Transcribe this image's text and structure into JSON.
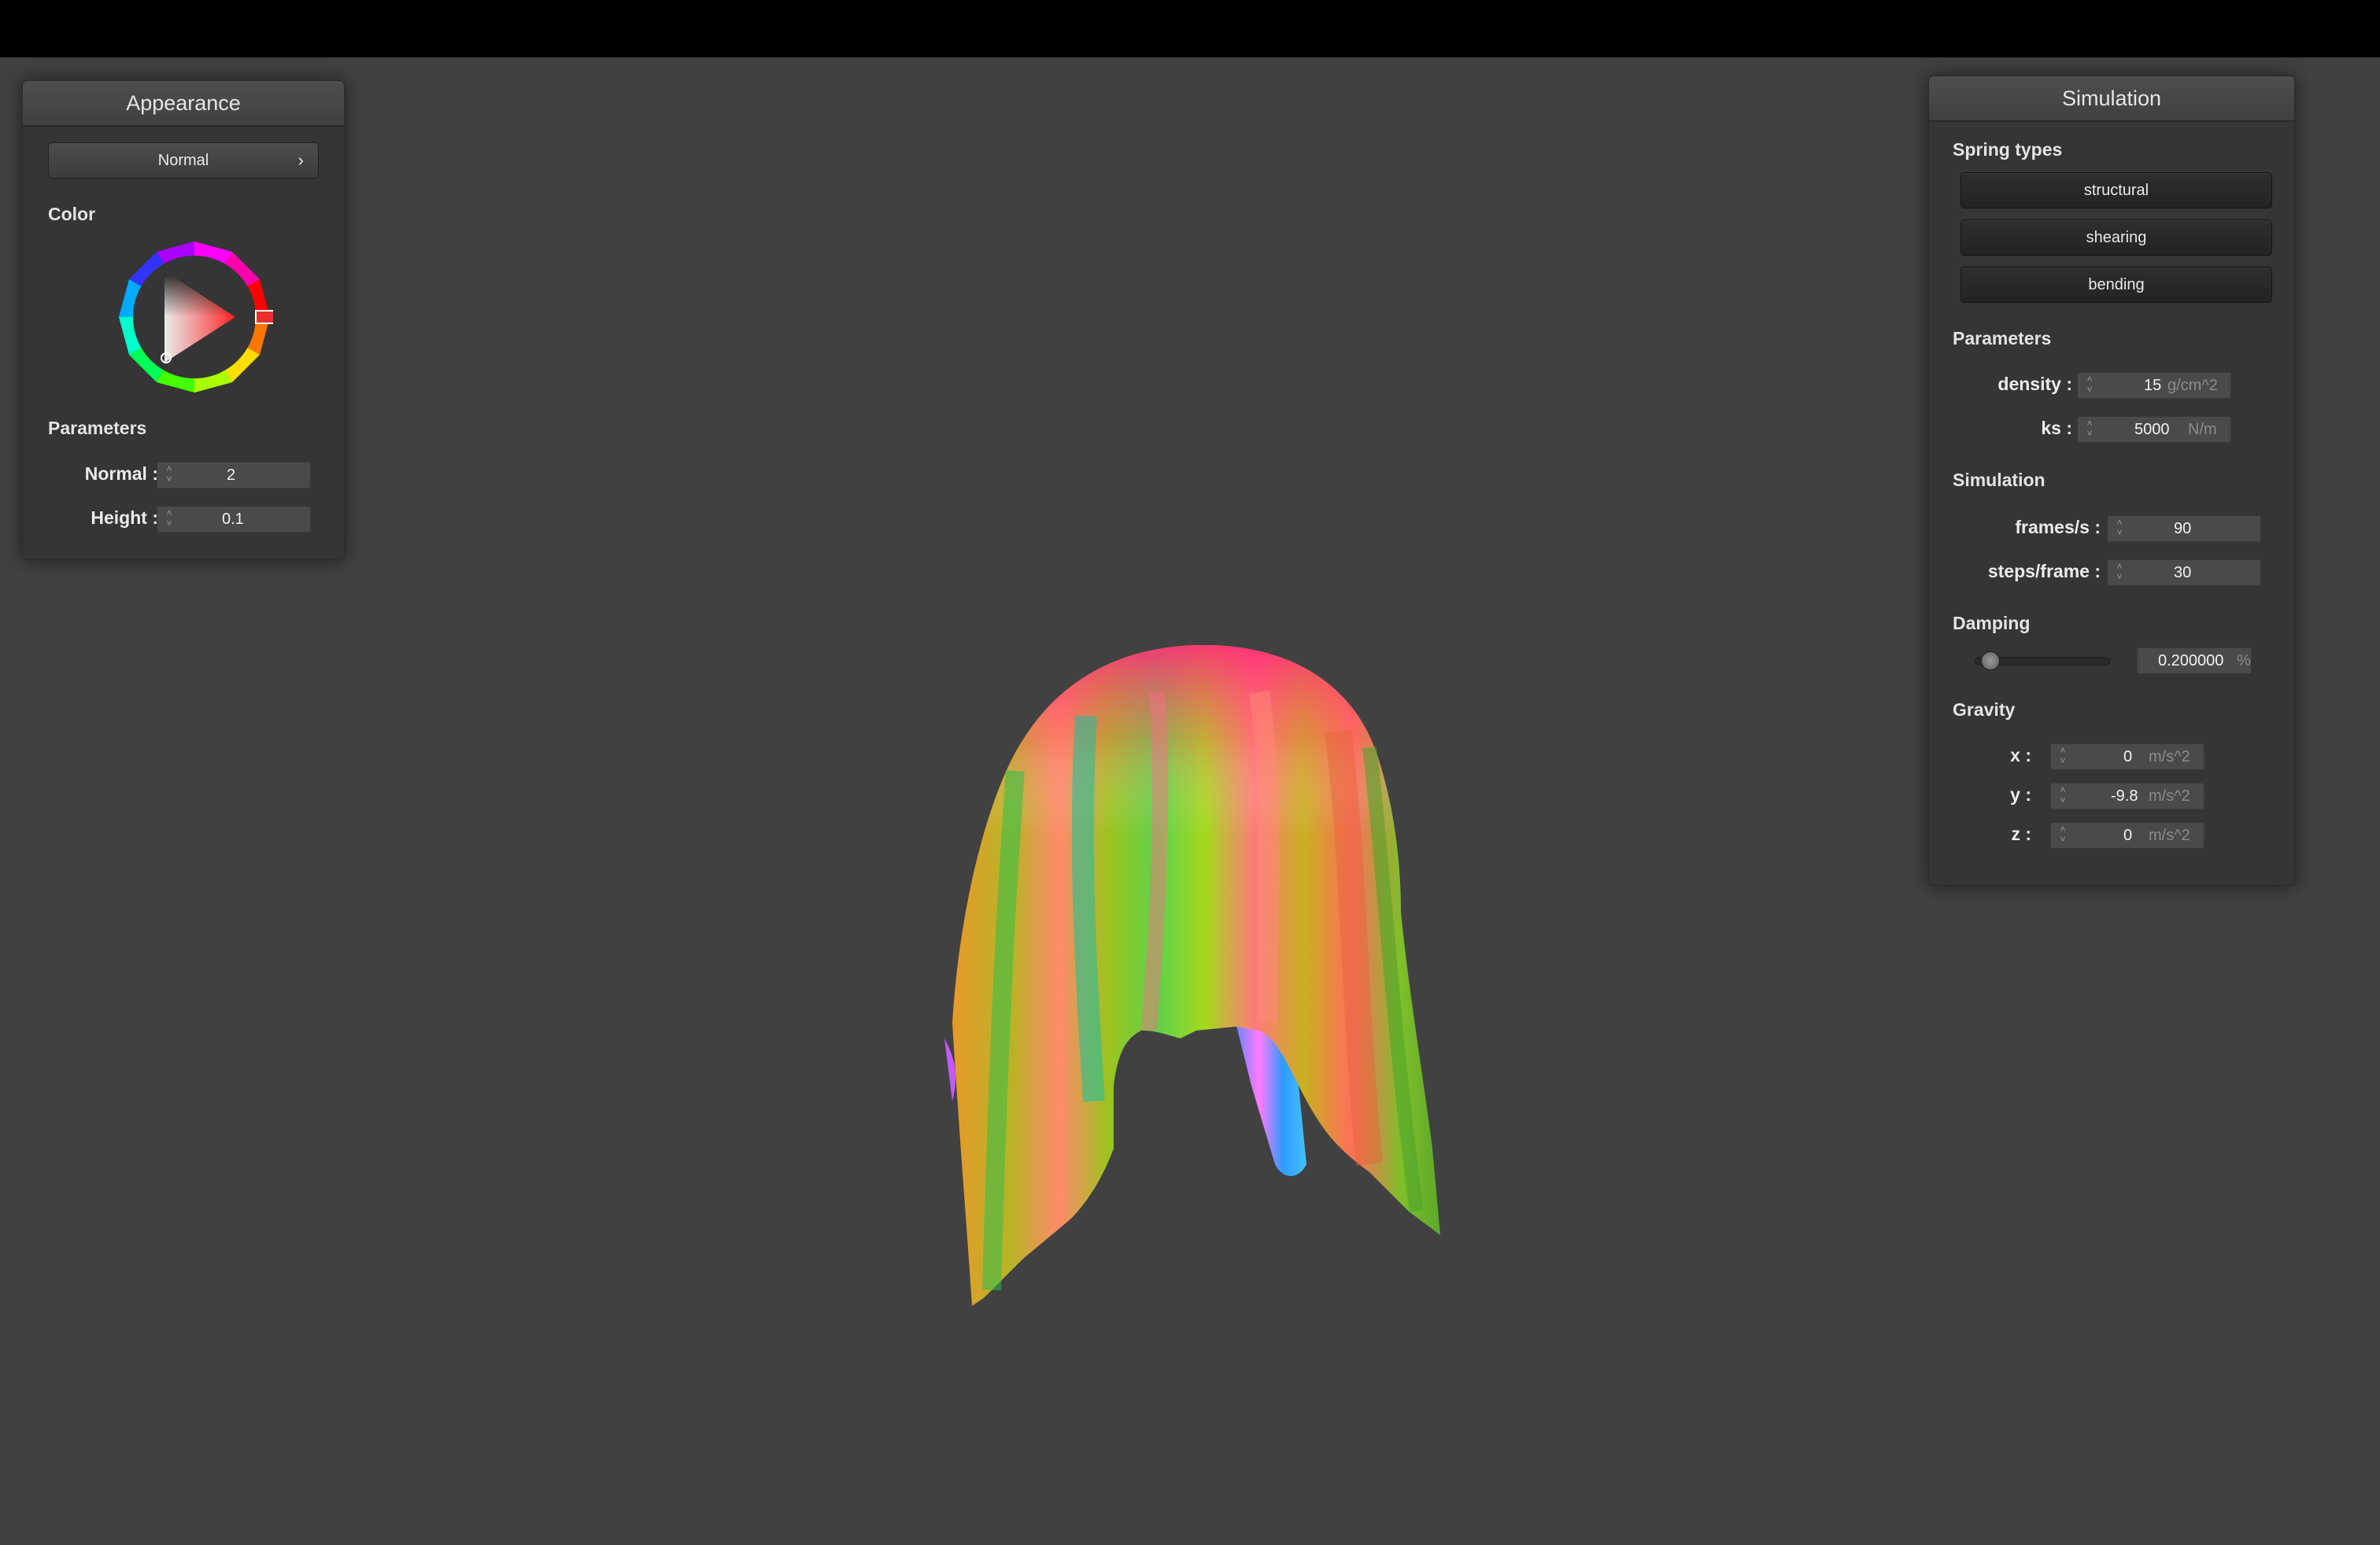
{
  "appearance": {
    "title": "Appearance",
    "shading_mode": "Normal",
    "color_label": "Color",
    "color_wheel_icon": "color-wheel-icon",
    "parameters_label": "Parameters",
    "params": [
      {
        "label": "Normal :",
        "value": "2"
      },
      {
        "label": "Height :",
        "value": "0.1"
      }
    ]
  },
  "simulation": {
    "title": "Simulation",
    "spring_types_label": "Spring types",
    "spring_types": [
      "structural",
      "shearing",
      "bending"
    ],
    "parameters_label": "Parameters",
    "params": [
      {
        "label": "density :",
        "value": "15",
        "unit": "g/cm^2"
      },
      {
        "label": "ks :",
        "value": "5000",
        "unit": "N/m"
      }
    ],
    "simulation_label": "Simulation",
    "sim_params": [
      {
        "label": "frames/s :",
        "value": "90"
      },
      {
        "label": "steps/frame :",
        "value": "30"
      }
    ],
    "damping_label": "Damping",
    "damping_value": "0.200000",
    "damping_unit": "%",
    "damping_fraction": 0.2,
    "gravity_label": "Gravity",
    "gravity": [
      {
        "label": "x :",
        "value": "0",
        "unit": "m/s^2"
      },
      {
        "label": "y :",
        "value": "-9.8",
        "unit": "m/s^2"
      },
      {
        "label": "z :",
        "value": "0",
        "unit": "m/s^2"
      }
    ]
  },
  "scene": {
    "object": "draped-cloth-normal-shaded",
    "colors": {
      "background": "#414141",
      "topbar": "#000000",
      "panel": "#353535",
      "accent_red": "#e62a2a"
    }
  }
}
